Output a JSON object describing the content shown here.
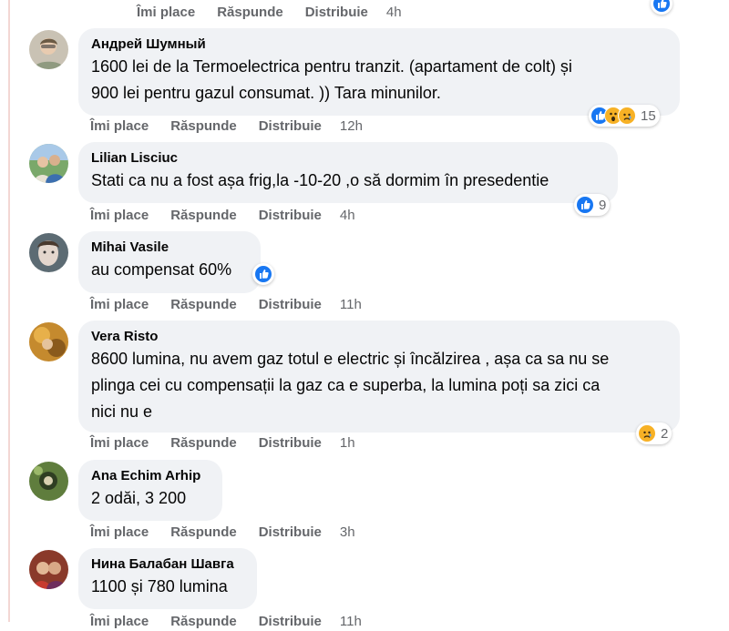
{
  "top_actions": {
    "like": "Îmi place",
    "reply": "Răspunde",
    "share": "Distribuie",
    "time": "4h"
  },
  "comments": [
    {
      "author": "Андрей Шумный",
      "text": "1600 lei de la Termoelectrica pentru tranzit. (apartament de colt) și 900 lei pentru gazul consumat. )) Tara minunilor.",
      "line1": "1600 lei de la Termoelectrica pentru tranzit. (apartament de colt) și",
      "line2": "900 lei pentru gazul consumat. )) Tara minunilor.",
      "reactions": [
        "like",
        "wow",
        "sad"
      ],
      "reaction_count": "15",
      "time": "12h"
    },
    {
      "author": "Lilian Lisciuc",
      "text": "Stati ca nu a fost așa frig,la -10-20 ,o să dormim în presedentie",
      "reactions": [
        "like"
      ],
      "reaction_count": "9",
      "time": "4h"
    },
    {
      "author": "Mihai Vasile",
      "text": "au compensat 60%",
      "reactions": [
        "like"
      ],
      "reaction_count": "",
      "time": "11h"
    },
    {
      "author": "Vera Risto",
      "text": "8600 lumina, nu avem gaz totul e electric și încălzirea , așa ca sa nu se plinga cei cu compensații la gaz ca e superba, la lumina poți sa zici ca nici nu e",
      "line1": "8600 lumina, nu avem gaz totul e electric și încălzirea , așa ca sa nu se",
      "line2": "plinga cei cu compensații la gaz ca e superba, la lumina poți sa zici ca",
      "line3": "nici nu e",
      "reactions": [
        "sad"
      ],
      "reaction_count": "2",
      "time": "1h"
    },
    {
      "author": "Ana Echim Arhip",
      "text": "2 odăi, 3 200",
      "reactions": [],
      "reaction_count": "",
      "time": "3h"
    },
    {
      "author": "Нина Балабан Шавга",
      "text": "1100 și 780 lumina",
      "reactions": [],
      "reaction_count": "",
      "time": "11h"
    }
  ],
  "labels": {
    "like": "Îmi place",
    "reply": "Răspunde",
    "share": "Distribuie"
  },
  "colors": {
    "bubble": "#f0f2f5",
    "meta_text": "#65676b",
    "like_blue": "#1877f2",
    "emoji_yellow": "#f7b125"
  }
}
